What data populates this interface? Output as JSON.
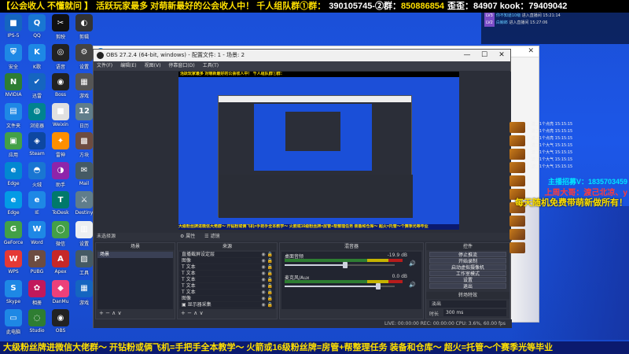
{
  "banner_top": {
    "part1": "【公会收人 不懂就问 】",
    "part2": "活跃玩家最多 对萌新最好的公会收人中！ 千人组队群①群：",
    "part3": "390105745-②群：",
    "part4": "850886854",
    "part5": "歪歪：",
    "part6": "84907 kook：79409042"
  },
  "banner_bottom": "大级粉丝牌进微信大佬群～ 开钻粉或俩飞机=手把手全本教学～ 火箭或16级粉丝牌=房管+帮整理任务 装备和仓库～ 超火=托管～个赛季光等毕业",
  "desktop_icons": [
    {
      "label": "IPS-5",
      "color": "#1565c0",
      "glyph": "■"
    },
    {
      "label": "QQ",
      "color": "#1976d2",
      "glyph": "Q"
    },
    {
      "label": "剪映",
      "color": "#111111",
      "glyph": "✂"
    },
    {
      "label": "剪辑",
      "color": "#333333",
      "glyph": "◐"
    },
    {
      "label": "安全",
      "color": "#1e88e5",
      "glyph": "⛨"
    },
    {
      "label": "K歌",
      "color": "#1e88e5",
      "glyph": "K"
    },
    {
      "label": "语音",
      "color": "#222222",
      "glyph": "◎"
    },
    {
      "label": "设置",
      "color": "#444444",
      "glyph": "⚙"
    },
    {
      "label": "NVIDIA",
      "color": "#2e7d32",
      "glyph": "N"
    },
    {
      "label": "迅雷",
      "color": "#1565c0",
      "glyph": "✔"
    },
    {
      "label": "Boss",
      "color": "#222222",
      "glyph": "◉"
    },
    {
      "label": "游戏",
      "color": "#555555",
      "glyph": "▦"
    },
    {
      "label": "文件夹",
      "color": "#1e88e5",
      "glyph": "▤"
    },
    {
      "label": "浏览器",
      "color": "#00838f",
      "glyph": "◍"
    },
    {
      "label": "Weixin",
      "color": "#e0e0e0",
      "glyph": "■"
    },
    {
      "label": "日历",
      "color": "#607d8b",
      "glyph": "12"
    },
    {
      "label": "应用",
      "color": "#43a047",
      "glyph": "▣"
    },
    {
      "label": "Steam",
      "color": "#0d47a1",
      "glyph": "◈"
    },
    {
      "label": "雷神",
      "color": "#ff8f00",
      "glyph": "✦"
    },
    {
      "label": "方块",
      "color": "#6d4c41",
      "glyph": "▩"
    },
    {
      "label": "Edge",
      "color": "#0288d1",
      "glyph": "e"
    },
    {
      "label": "火绒",
      "color": "#1976d2",
      "glyph": "◓"
    },
    {
      "label": "助手",
      "color": "#8e24aa",
      "glyph": "◑"
    },
    {
      "label": "Mail",
      "color": "#455a64",
      "glyph": "✉"
    },
    {
      "label": "Edge",
      "color": "#039be5",
      "glyph": "e"
    },
    {
      "label": "IE",
      "color": "#1e88e5",
      "glyph": "e"
    },
    {
      "label": "ToDesk",
      "color": "#00796b",
      "glyph": "T"
    },
    {
      "label": "Destiny",
      "color": "#607d8b",
      "glyph": "⚔"
    },
    {
      "label": "GeForce",
      "color": "#43a047",
      "glyph": "G"
    },
    {
      "label": "Word",
      "color": "#1e88e5",
      "glyph": "W"
    },
    {
      "label": "微信",
      "color": "#43a047",
      "glyph": "◯"
    },
    {
      "label": "设置",
      "color": "#eceff1",
      "glyph": "▥"
    },
    {
      "label": "WPS",
      "color": "#e53935",
      "glyph": "W"
    },
    {
      "label": "PUBG",
      "color": "#6d4c41",
      "glyph": "P"
    },
    {
      "label": "Apex",
      "color": "#c62828",
      "glyph": "A"
    },
    {
      "label": "工具",
      "color": "#455a64",
      "glyph": "▨"
    },
    {
      "label": "Skype",
      "color": "#1e88e5",
      "glyph": "S"
    },
    {
      "label": "相册",
      "color": "#c2185b",
      "glyph": "✿"
    },
    {
      "label": "DanMu",
      "color": "#ec407a",
      "glyph": "◆"
    },
    {
      "label": "游戏",
      "color": "#1565c0",
      "glyph": "▦"
    },
    {
      "label": "此电脑",
      "color": "#1e88e5",
      "glyph": "▭"
    },
    {
      "label": "Studio",
      "color": "#2e7d32",
      "glyph": "◌"
    },
    {
      "label": "OBS",
      "color": "#222222",
      "glyph": "◉"
    }
  ],
  "obs": {
    "title": "OBS 27.2.4 (64-bit, windows) - 配置文件: 1 - 场景: 2",
    "menu": [
      "文件(F)",
      "编辑(E)",
      "视图(V)",
      "停靠窗口(D)",
      "工具(T)"
    ],
    "no_source": "未选择源",
    "properties": "⚙ 属性",
    "filters": "☰ 滤镜",
    "panels": {
      "scenes": {
        "title": "场景",
        "items": [
          "场景"
        ]
      },
      "sources": {
        "title": "来源",
        "items": [
          {
            "name": "直播截屏设定层",
            "v": "◉ 🔒"
          },
          {
            "name": "图像",
            "v": "◉ 🔒"
          },
          {
            "name": "T 文本",
            "v": "◉ 🔒"
          },
          {
            "name": "T 文本",
            "v": "◉ 🔒"
          },
          {
            "name": "T 文本",
            "v": "◉ 🔒"
          },
          {
            "name": "T 文本",
            "v": "◉ 🔒"
          },
          {
            "name": "T 文本",
            "v": "◉ 🔒"
          },
          {
            "name": "图像",
            "v": "◉ 🔒"
          },
          {
            "name": "▣ 显示器采集",
            "v": "◉ 🔒"
          }
        ]
      },
      "mixer": {
        "title": "混音器",
        "channels": [
          {
            "name": "桌面音频",
            "db": "-19.9 dB",
            "level": 0.55
          },
          {
            "name": "麦克风/Aux",
            "db": "0.0 dB",
            "level": 0.85
          }
        ]
      },
      "transitions": {
        "title": "转场特效",
        "type": "淡出",
        "duration_label": "时长",
        "duration": "300 ms"
      },
      "controls": {
        "title": "控件",
        "buttons": [
          "停止推流",
          "开始录制",
          "启动虚拟摄像机",
          "工作室模式",
          "设置",
          "退出"
        ]
      }
    },
    "footer_icons": "+ − ∧ ∨",
    "status": "LIVE: 00:00:00   REC: 00:00:00   CPU: 3.6%, 60.00 fps"
  },
  "chat": [
    {
      "lv": "LV3",
      "name": "你不知道10级",
      "text": "进入直播间 15:21:14"
    },
    {
      "lv": "LV2",
      "name": "白鲸郎",
      "text": "进入直播间 15:27:06"
    }
  ],
  "gift_msgs": [
    "送了1个点亮  15:15:15",
    "送了1个点亮  15:15:15",
    "送了1个点亮  15:15:15",
    "送了1个大气  15:15:15",
    "送了1个大气  15:15:15",
    "送了1个大气  15:15:15",
    "送了1个大气  15:15:15"
  ],
  "overlay": {
    "line1": "主播招募V：1835703459",
    "line2": "上周大哥：渡己北凉、y",
    "line3": "每天随机免费带萌新做所有！"
  }
}
